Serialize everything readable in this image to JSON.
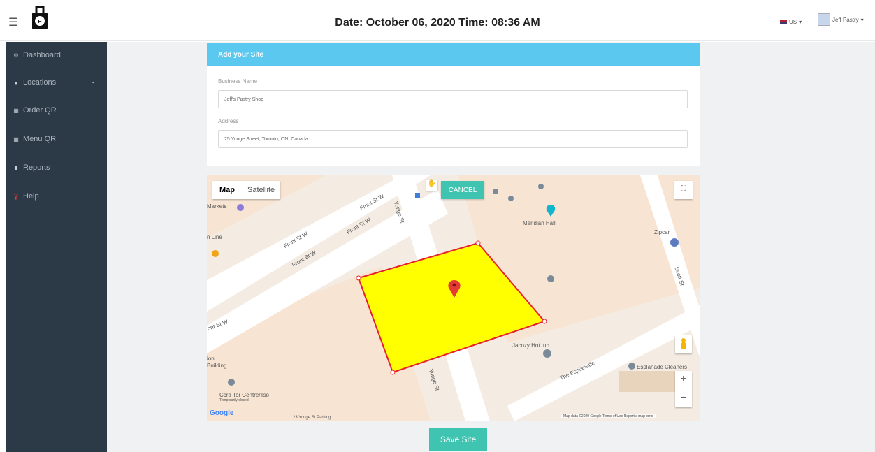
{
  "header": {
    "datetime": "Date: October 06, 2020  Time: 08:36 AM",
    "language": "US",
    "user_name": "Jeff Pastry",
    "logo_text": "H"
  },
  "sidebar": {
    "items": [
      {
        "label": "Dashboard",
        "icon": "dashboard-icon"
      },
      {
        "label": "Locations",
        "icon": "map-marker-icon"
      },
      {
        "label": "Order QR",
        "icon": "qr-icon"
      },
      {
        "label": "Menu QR",
        "icon": "qr-icon"
      },
      {
        "label": "Reports",
        "icon": "file-icon"
      },
      {
        "label": "Help",
        "icon": "help-icon"
      }
    ]
  },
  "form": {
    "title": "Add your Site",
    "business_label": "Business Name",
    "business_value": "Jeff's Pastry Shop",
    "address_label": "Address",
    "address_value": "25 Yonge Street, Toronto, ON, Canada"
  },
  "map": {
    "type_map": "Map",
    "type_satellite": "Satellite",
    "cancel_label": "CANCEL",
    "attribution": "Map data ©2020 Google   Terms of Use   Report a map error",
    "google_logo": "Google",
    "labels": {
      "markets": "Markets",
      "line": "n Line",
      "meridian": "Meridian Hall",
      "zipcar": "Zipcar",
      "front1": "Front St W",
      "front2": "Front St W",
      "front3": "Front St W",
      "front4": "Front St W",
      "front5": "ont St W",
      "yonge1": "Yonge St",
      "yonge2": "Yonge St",
      "scott": "Scott St",
      "jacozy": "Jacozy Hot tub",
      "esplanade": "The Esplanade",
      "esplanade_cleaners": "Esplanade Cleaners",
      "building": "Building",
      "ion": "ion",
      "ccra": "Ccra Tor Centre/Tso",
      "closed": "Temporarily closed",
      "parking": "23 Yonge St Parking"
    }
  },
  "actions": {
    "save_label": "Save Site"
  },
  "colors": {
    "sidebar": "#2c3a47",
    "header_accent": "#5bc8f0",
    "button": "#3ec4b0",
    "polygon_fill": "#ffff00",
    "polygon_stroke": "#e8202a"
  }
}
